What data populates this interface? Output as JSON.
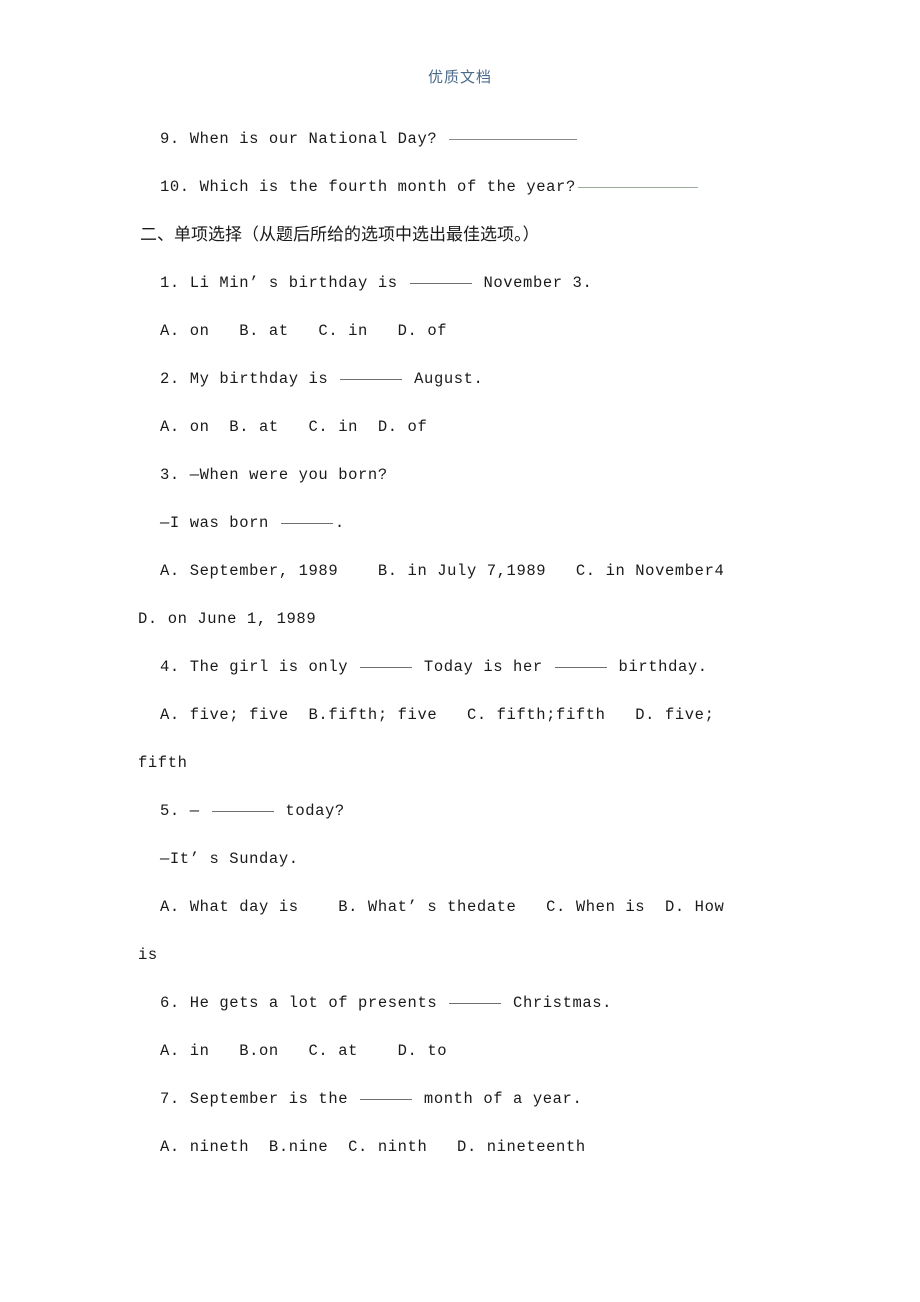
{
  "header": {
    "watermark": "优质文档"
  },
  "document": {
    "lines": [
      {
        "id": "q9",
        "text": "9. When is our National Day? ",
        "blank": "lg"
      },
      {
        "id": "q10",
        "text": "10. Which is the fourth month of the year?",
        "blank": "xl"
      },
      {
        "id": "section-2",
        "text": "二、单项选择（从题后所给的选项中选出最佳选项。）",
        "cjk": true
      },
      {
        "id": "q1",
        "text": "1. Li Min’ s birthday is ",
        "blank": "md",
        "text_after": " November 3."
      },
      {
        "id": "q1-opts",
        "text": "A. on   B. at   C. in   D. of"
      },
      {
        "id": "q2",
        "text": "2. My birthday is ",
        "blank": "md",
        "text_after": " August."
      },
      {
        "id": "q2-opts",
        "text": "A. on  B. at   C. in  D. of"
      },
      {
        "id": "q3",
        "text": "3. —When were you born?"
      },
      {
        "id": "q3-b",
        "text": "—I was born ",
        "blank": "sm",
        "text_after": "."
      },
      {
        "id": "q3-opts",
        "text": "A. September, 1989    B. in July 7,1989   C. in November4"
      },
      {
        "id": "q3-optd",
        "text": "D. on June 1, 1989",
        "flush": true
      },
      {
        "id": "q4",
        "text": "4. The girl is only ",
        "blank": "sm",
        "text_after": " Today is her ",
        "blank2": "sm",
        "text_after2": " birthday."
      },
      {
        "id": "q4-opts",
        "text": "A. five; five  B.fifth; five   C. fifth;fifth   D. five;"
      },
      {
        "id": "q4-optd",
        "text": "fifth",
        "flush": true
      },
      {
        "id": "q5",
        "text": "5. — ",
        "blank": "md",
        "text_after": " today?"
      },
      {
        "id": "q5-b",
        "text": "—It’ s Sunday."
      },
      {
        "id": "q5-opts",
        "text": "A. What day is    B. What’ s thedate   C. When is  D. How"
      },
      {
        "id": "q5-optd",
        "text": "is",
        "flush": true
      },
      {
        "id": "q6",
        "text": "6. He gets a lot of presents ",
        "blank": "sm",
        "text_after": " Christmas."
      },
      {
        "id": "q6-opts",
        "text": "A. in   B.on   C. at    D. to"
      },
      {
        "id": "q7",
        "text": "7. September is the ",
        "blank": "sm",
        "text_after": " month of a year."
      },
      {
        "id": "q7-opts",
        "text": "A. nineth  B.nine  C. ninth   D. nineteenth"
      }
    ]
  },
  "colors": {
    "watermark": "#4a6a8a",
    "text": "#1a1a1a",
    "blank_rule": "#6f6f6f",
    "blank_rule_tinted": "#9aa99a",
    "background": "#ffffff"
  }
}
